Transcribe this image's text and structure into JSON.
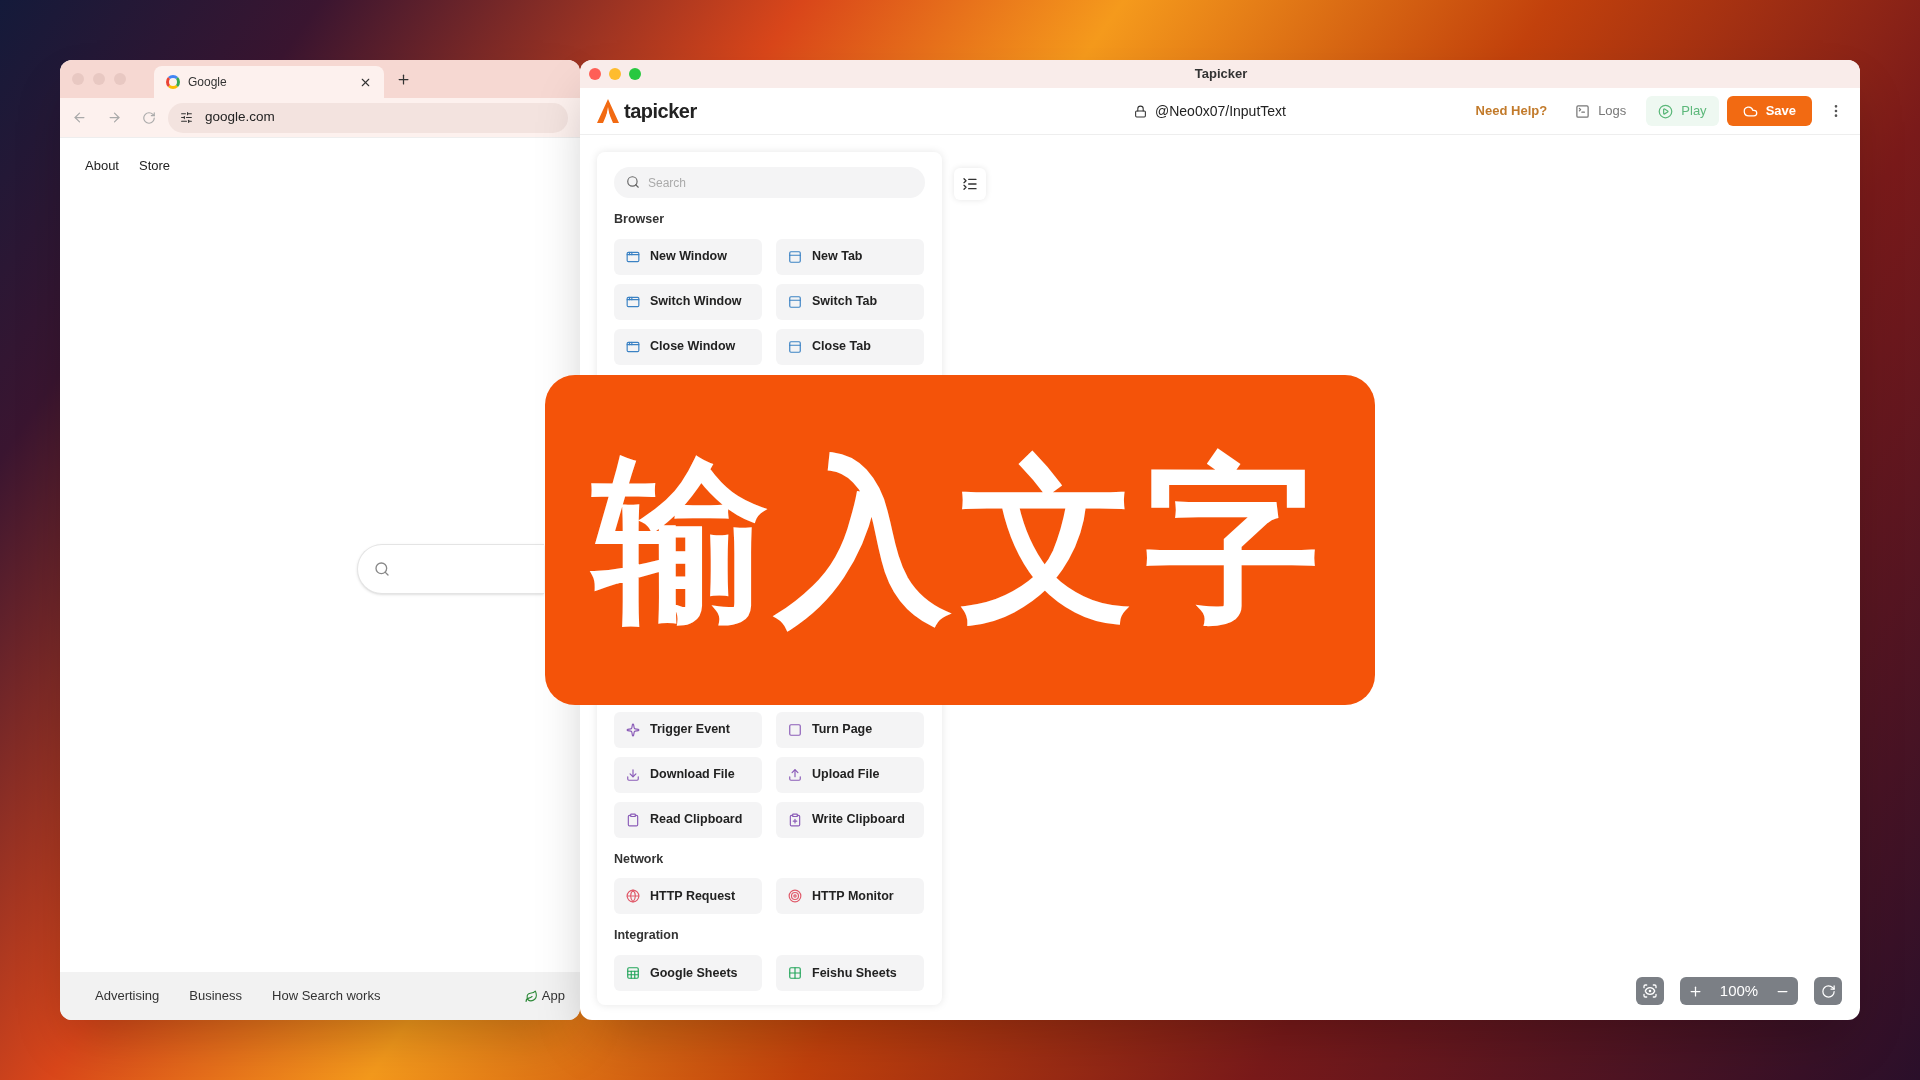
{
  "browser": {
    "tab_title": "Google",
    "address": "google.com",
    "top_links": [
      "About",
      "Store"
    ],
    "footer_links": [
      "Advertising",
      "Business",
      "How Search works"
    ],
    "footer_cut_link": "App"
  },
  "app": {
    "title": "Tapicker",
    "logo": "tapicker",
    "path": "@Neo0x07/InputText",
    "actions": [
      {
        "label": "Need Help?",
        "kind": "help"
      },
      {
        "label": "Logs",
        "kind": "logs"
      },
      {
        "label": "Play",
        "kind": "play"
      },
      {
        "label": "Save",
        "kind": "save"
      }
    ],
    "sidebar": {
      "search_placeholder": "Search",
      "top_sections": [
        {
          "title": "Browser",
          "items": [
            {
              "label": "New Window"
            },
            {
              "label": "New Tab"
            },
            {
              "label": "Switch Window"
            },
            {
              "label": "Switch Tab"
            },
            {
              "label": "Close Window"
            },
            {
              "label": "Close Tab"
            }
          ]
        }
      ],
      "bottom_sections": [
        {
          "items": [
            {
              "label": "Trigger Event"
            },
            {
              "label": "Turn Page"
            },
            {
              "label": "Download File"
            },
            {
              "label": "Upload File"
            },
            {
              "label": "Read Clipboard"
            },
            {
              "label": "Write Clipboard"
            }
          ]
        },
        {
          "title": "Network",
          "items": [
            {
              "label": "HTTP Request"
            },
            {
              "label": "HTTP Monitor"
            }
          ]
        },
        {
          "title": "Integration",
          "items": [
            {
              "label": "Google Sheets"
            },
            {
              "label": "Feishu Sheets"
            }
          ]
        }
      ]
    },
    "zoom_level": "100%"
  },
  "banner": {
    "text": "输入文字"
  }
}
